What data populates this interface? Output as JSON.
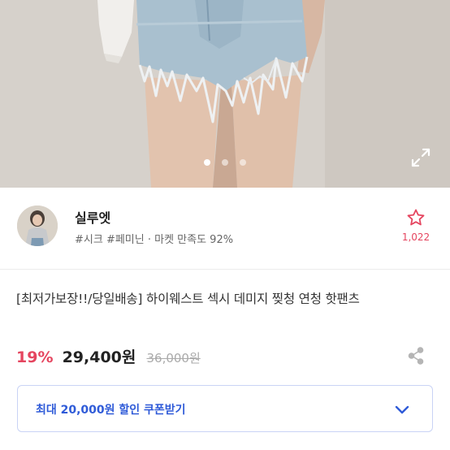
{
  "gallery": {
    "image_alt": "product photo",
    "slides": 3,
    "active_slide": 1,
    "expand_icon": "expand-icon"
  },
  "seller": {
    "name": "실루엣",
    "meta": "#시크 #페미닌 · 마켓 만족도 92%",
    "favorite_icon": "star-outline-icon",
    "favorite_count": "1,022"
  },
  "product": {
    "title": "[최저가보장!!/당일배송] 하이웨스트 섹시 데미지 찢청 연청 핫팬츠",
    "discount": "19%",
    "price": "29,400원",
    "original_price": "36,000원",
    "share_icon": "share-icon"
  },
  "coupon": {
    "label": "최대 20,000원 할인 쿠폰받기",
    "icon": "chevron-down-icon"
  },
  "colors": {
    "accent_red": "#e5455f",
    "accent_blue": "#2f5bd8",
    "coupon_border": "#c9d3f5"
  }
}
